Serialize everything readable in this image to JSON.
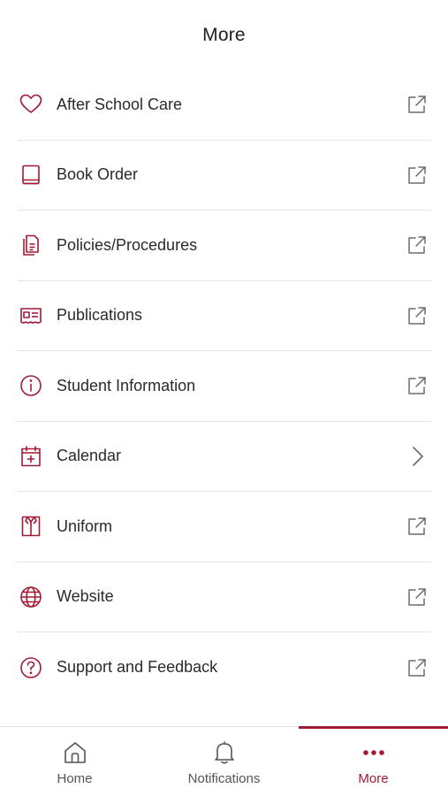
{
  "header": {
    "title": "More"
  },
  "colors": {
    "accent": "#a31a35",
    "icon_gray": "#6b6b6b",
    "divider": "#e4e4e4"
  },
  "menu": {
    "items": [
      {
        "label": "After School Care",
        "icon": "heart-icon",
        "trailing": "external-link-icon"
      },
      {
        "label": "Book Order",
        "icon": "book-icon",
        "trailing": "external-link-icon"
      },
      {
        "label": "Policies/Procedures",
        "icon": "document-icon",
        "trailing": "external-link-icon"
      },
      {
        "label": "Publications",
        "icon": "newsletter-icon",
        "trailing": "external-link-icon"
      },
      {
        "label": "Student Information",
        "icon": "info-icon",
        "trailing": "external-link-icon"
      },
      {
        "label": "Calendar",
        "icon": "calendar-icon",
        "trailing": "chevron-right-icon"
      },
      {
        "label": "Uniform",
        "icon": "shirt-icon",
        "trailing": "external-link-icon"
      },
      {
        "label": "Website",
        "icon": "globe-icon",
        "trailing": "external-link-icon"
      },
      {
        "label": "Support and Feedback",
        "icon": "question-icon",
        "trailing": "external-link-icon"
      }
    ]
  },
  "tabbar": {
    "tabs": [
      {
        "label": "Home",
        "icon": "home-icon",
        "active": false
      },
      {
        "label": "Notifications",
        "icon": "bell-icon",
        "active": false
      },
      {
        "label": "More",
        "icon": "more-dots-icon",
        "active": true
      }
    ]
  }
}
